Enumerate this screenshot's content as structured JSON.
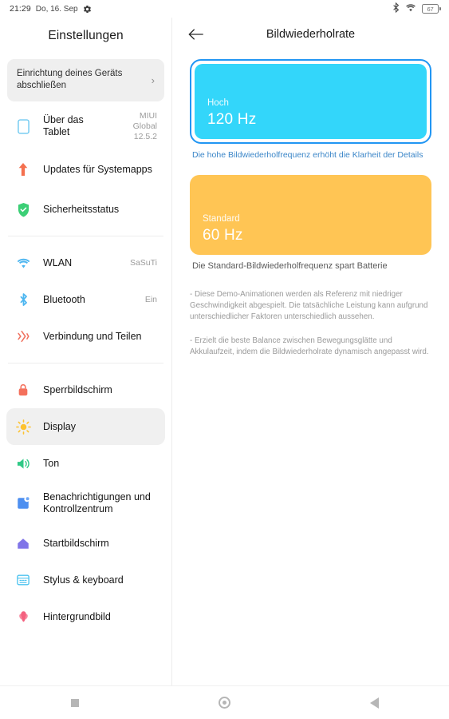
{
  "statusbar": {
    "time": "21:29",
    "date": "Do, 16. Sep",
    "gear_icon": "gear-icon",
    "bluetooth_icon": "bluetooth-icon",
    "wifi_icon": "wifi-icon",
    "battery_icon": "battery-icon",
    "battery_level": "67"
  },
  "sidebar": {
    "title": "Einstellungen",
    "setup_card": {
      "text": "Einrichtung deines Geräts abschließen",
      "chevron": "›"
    },
    "groups": [
      {
        "items": [
          {
            "icon": "tablet-icon",
            "label": "Über das Tablet",
            "value": "MIUI Global 12.5.2",
            "selected": false
          },
          {
            "icon": "system-update-icon",
            "label": "Updates für Systemapps",
            "value": "",
            "selected": false
          },
          {
            "icon": "shield-check-icon",
            "label": "Sicherheitsstatus",
            "value": "",
            "selected": false
          }
        ]
      },
      {
        "items": [
          {
            "icon": "wifi-icon",
            "label": "WLAN",
            "value": "SaSuTi",
            "selected": false
          },
          {
            "icon": "bluetooth-icon",
            "label": "Bluetooth",
            "value": "Ein",
            "selected": false
          },
          {
            "icon": "connection-share-icon",
            "label": "Verbindung und Teilen",
            "value": "",
            "selected": false
          }
        ]
      },
      {
        "items": [
          {
            "icon": "lock-icon",
            "label": "Sperrbildschirm",
            "value": "",
            "selected": false
          },
          {
            "icon": "sun-icon",
            "label": "Display",
            "value": "",
            "selected": true
          },
          {
            "icon": "speaker-icon",
            "label": "Ton",
            "value": "",
            "selected": false
          },
          {
            "icon": "notification-icon",
            "label": "Benachrichtigungen und Kontrollzentrum",
            "value": "",
            "selected": false
          },
          {
            "icon": "home-icon",
            "label": "Startbildschirm",
            "value": "",
            "selected": false
          },
          {
            "icon": "keyboard-icon",
            "label": "Stylus & keyboard",
            "value": "",
            "selected": false
          },
          {
            "icon": "wallpaper-icon",
            "label": "Hintergrundbild",
            "value": "",
            "selected": false
          }
        ]
      }
    ]
  },
  "content": {
    "back_icon": "back-arrow-icon",
    "title": "Bildwiederholrate",
    "options": [
      {
        "name": "Hoch",
        "hz": "120 Hz",
        "description": "Die hohe Bildwiederholfrequenz erhöht die Klarheit der Details",
        "selected": true,
        "color": "#33d6fa"
      },
      {
        "name": "Standard",
        "hz": "60 Hz",
        "description": "Die Standard-Bildwiederholfrequenz spart Batterie",
        "selected": false,
        "color": "#ffc554"
      }
    ],
    "footnotes": [
      "- Diese Demo-Animationen werden als Referenz mit niedriger Geschwindigkeit abgespielt. Die tatsächliche Leistung kann aufgrund unterschiedlicher Faktoren unterschiedlich aussehen.",
      "- Erzielt die beste Balance zwischen Bewegungsglätte und Akkulaufzeit, indem die Bildwiederholrate dynamisch angepasst wird."
    ],
    "selection_color": "#2196f3"
  },
  "navbar": {
    "recents_icon": "recents-square-icon",
    "home_icon": "home-circle-icon",
    "back_icon": "back-triangle-icon"
  }
}
